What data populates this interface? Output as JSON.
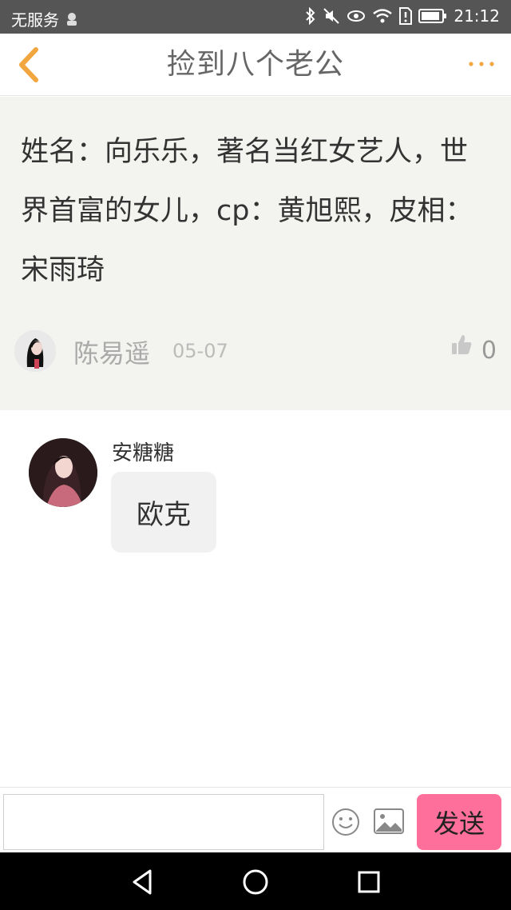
{
  "status_bar": {
    "carrier": "无服务",
    "time": "21:12",
    "icons": [
      "notification-icon",
      "bluetooth-icon",
      "mute-icon",
      "eye-comfort-icon",
      "wifi-icon",
      "sim-alert-icon",
      "battery-icon"
    ]
  },
  "header": {
    "title": "捡到八个老公",
    "back_icon": "chevron-left-icon",
    "more_icon": "more-dots-icon"
  },
  "post": {
    "text": "姓名：向乐乐，著名当红女艺人，世界首富的女儿，cp：黄旭熙，皮相：宋雨琦",
    "author": "陈易遥",
    "date": "05-07",
    "likes": "0"
  },
  "comments": [
    {
      "author": "安糖糖",
      "text": "欧克"
    }
  ],
  "input_bar": {
    "placeholder": "",
    "value": "",
    "send_label": "发送",
    "emoji_icon": "emoji-icon",
    "image_icon": "image-icon"
  },
  "navigation_bar": {
    "icons": [
      "back-triangle-icon",
      "home-circle-icon",
      "recents-square-icon"
    ]
  },
  "colors": {
    "status_bar_bg": "#555555",
    "post_bg": "#f3f3ef",
    "accent_orange": "#f2a640",
    "send_button": "#ff6f9b"
  }
}
